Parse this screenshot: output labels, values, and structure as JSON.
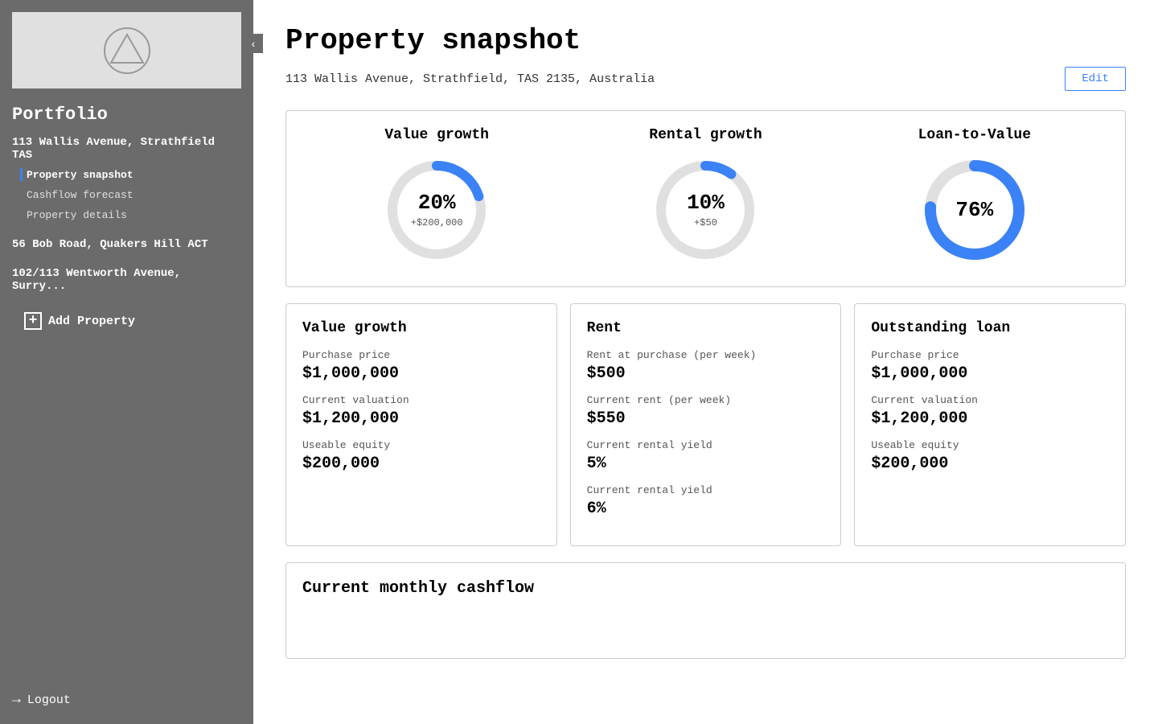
{
  "sidebar": {
    "portfolio_title": "Portfolio",
    "collapse_icon": "‹",
    "properties": [
      {
        "name": "113 Wallis Avenue, Strathfield TAS",
        "subnav": [
          {
            "label": "Property snapshot",
            "active": true
          },
          {
            "label": "Cashflow forecast",
            "active": false
          },
          {
            "label": "Property details",
            "active": false
          }
        ]
      },
      {
        "name": "56 Bob Road, Quakers Hill ACT",
        "subnav": []
      },
      {
        "name": "102/113 Wentworth Avenue, Surry...",
        "subnav": []
      }
    ],
    "add_property_label": "Add Property",
    "logout_label": "Logout"
  },
  "main": {
    "page_title": "Property snapshot",
    "address": "113 Wallis Avenue, Strathfield, TAS 2135, Australia",
    "edit_button": "Edit",
    "gauges": [
      {
        "title": "Value growth",
        "percent": "20%",
        "sub": "+$200,000",
        "value": 20,
        "color": "#3b82f6"
      },
      {
        "title": "Rental growth",
        "percent": "10%",
        "sub": "+$50",
        "value": 10,
        "color": "#3b82f6"
      },
      {
        "title": "Loan-to-Value",
        "percent": "76%",
        "sub": "",
        "value": 76,
        "color": "#3b82f6"
      }
    ],
    "cards": [
      {
        "title": "Value growth",
        "fields": [
          {
            "label": "Purchase price",
            "value": "$1,000,000"
          },
          {
            "label": "Current valuation",
            "value": "$1,200,000"
          },
          {
            "label": "Useable equity",
            "value": "$200,000"
          }
        ]
      },
      {
        "title": "Rent",
        "fields": [
          {
            "label": "Rent at purchase (per week)",
            "value": "$500"
          },
          {
            "label": "Current rent (per week)",
            "value": "$550"
          },
          {
            "label": "Current rental yield",
            "value": "5%"
          },
          {
            "label": "Current rental yield",
            "value": "6%"
          }
        ]
      },
      {
        "title": "Outstanding loan",
        "fields": [
          {
            "label": "Purchase price",
            "value": "$1,000,000"
          },
          {
            "label": "Current valuation",
            "value": "$1,200,000"
          },
          {
            "label": "Useable equity",
            "value": "$200,000"
          }
        ]
      }
    ],
    "cashflow_title": "Current monthly cashflow"
  }
}
